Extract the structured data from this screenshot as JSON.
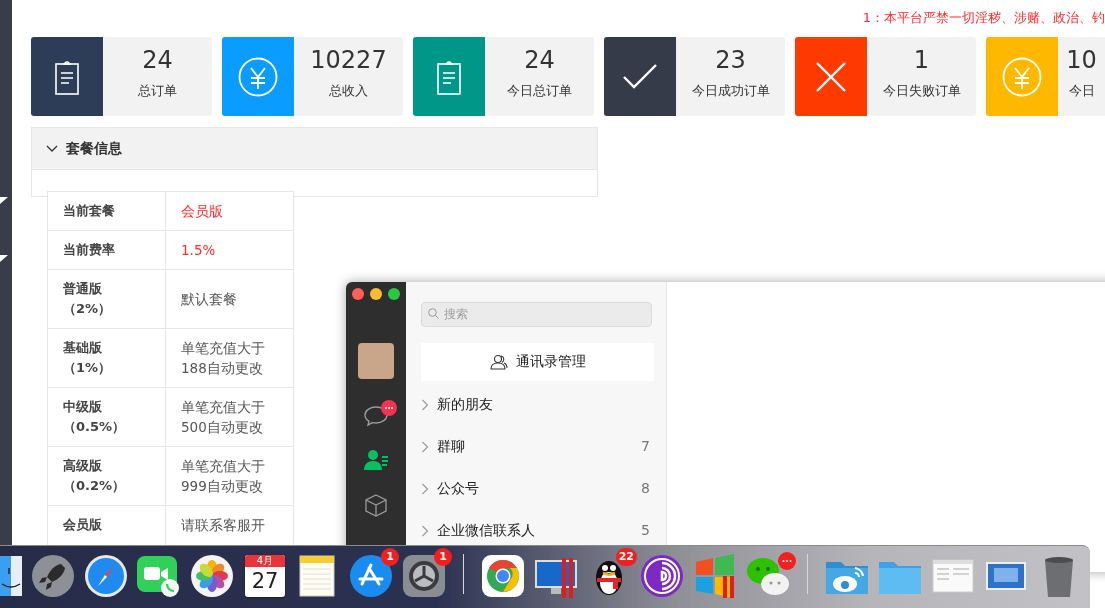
{
  "notice": "1：本平台严禁一切淫秽、涉赌、政治、钓",
  "stats": [
    {
      "kind": "clipboard",
      "color": "#2d3d58",
      "value": "24",
      "label": "总订单"
    },
    {
      "kind": "yen",
      "color": "#0a9cff",
      "value": "10227",
      "label": "总收入"
    },
    {
      "kind": "clipboard",
      "color": "#009688",
      "value": "24",
      "label": "今日总订单"
    },
    {
      "kind": "check",
      "color": "#363b4a",
      "value": "23",
      "label": "今日成功订单"
    },
    {
      "kind": "cross",
      "color": "#ff3a00",
      "value": "1",
      "label": "今日失败订单"
    },
    {
      "kind": "yen",
      "color": "#ffb800",
      "value": "10",
      "label": "今日"
    }
  ],
  "package_panel": {
    "title": "套餐信息",
    "expanded": true,
    "rows": [
      {
        "name": "当前套餐",
        "value": "会员版",
        "highlight": true
      },
      {
        "name": "当前费率",
        "value": "1.5%",
        "highlight": true
      },
      {
        "name": "普通版（2%）",
        "value": "默认套餐",
        "highlight": false
      },
      {
        "name": "基础版（1%）",
        "value": "单笔充值大于188自动更改",
        "highlight": false
      },
      {
        "name": "中级版（0.5%）",
        "value": "单笔充值大于500自动更改",
        "highlight": false
      },
      {
        "name": "高级版（0.2%）",
        "value": "单笔充值大于999自动更改",
        "highlight": false
      },
      {
        "name": "会员版",
        "value": "请联系客服开",
        "highlight": false
      }
    ]
  },
  "chat_window": {
    "nav": [
      {
        "kind": "chats",
        "selected": false,
        "badge": true
      },
      {
        "kind": "contacts",
        "selected": true,
        "badge": false
      },
      {
        "kind": "box",
        "selected": false,
        "badge": false
      }
    ],
    "search": {
      "placeholder": "搜索"
    },
    "manage_button": "通讯录管理",
    "contacts": [
      {
        "label": "新的朋友"
      },
      {
        "label": "群聊",
        "count": "7"
      },
      {
        "label": "公众号",
        "count": "8"
      },
      {
        "label": "企业微信联系人",
        "count": "5"
      }
    ]
  },
  "dock": [
    {
      "kind": "finder"
    },
    {
      "kind": "launchpad"
    },
    {
      "kind": "safari"
    },
    {
      "kind": "facetime"
    },
    {
      "kind": "photos"
    },
    {
      "kind": "calendar",
      "month": "4月",
      "day": "27"
    },
    {
      "kind": "notes"
    },
    {
      "kind": "appstore",
      "badge": "1"
    },
    {
      "kind": "settings",
      "badge": "1"
    },
    {
      "kind": "separator"
    },
    {
      "kind": "chrome"
    },
    {
      "kind": "monitor"
    },
    {
      "kind": "qq",
      "badge": "22"
    },
    {
      "kind": "tor"
    },
    {
      "kind": "windows"
    },
    {
      "kind": "wechat",
      "more": true
    },
    {
      "kind": "separator"
    },
    {
      "kind": "weibo-folder"
    },
    {
      "kind": "folder"
    },
    {
      "kind": "window-thumb"
    },
    {
      "kind": "screen-thumb"
    },
    {
      "kind": "trash"
    }
  ]
}
